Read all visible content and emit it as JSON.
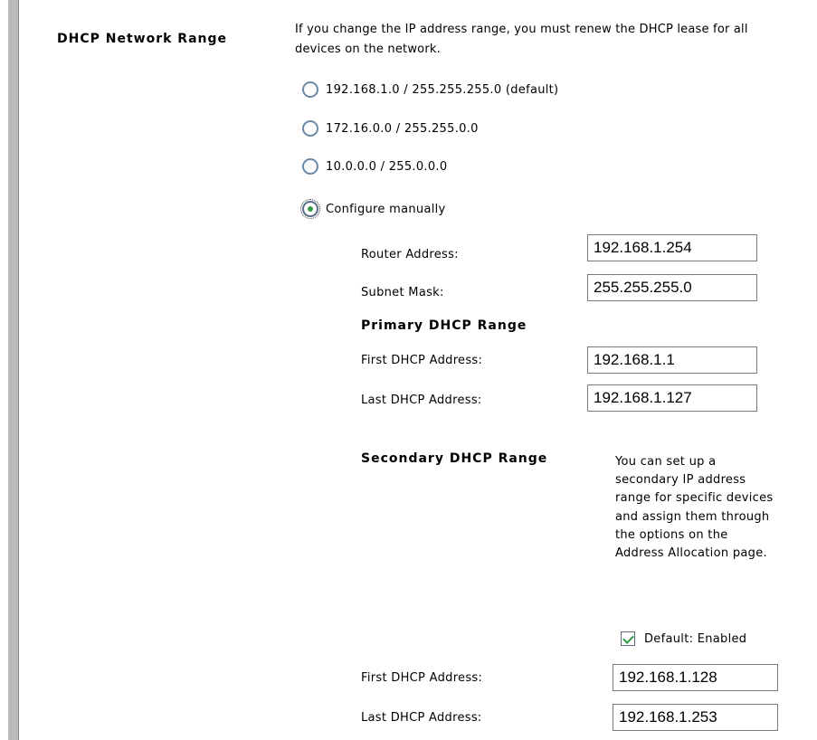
{
  "section": {
    "title": "DHCP Network Range",
    "intro": "If you change the IP address range, you must renew the DHCP lease for all devices on the network."
  },
  "range_options": [
    {
      "label": "192.168.1.0 / 255.255.255.0 (default)",
      "selected": false
    },
    {
      "label": "172.16.0.0 / 255.255.0.0",
      "selected": false
    },
    {
      "label": "10.0.0.0 / 255.0.0.0",
      "selected": false
    },
    {
      "label": "Configure manually",
      "selected": true
    }
  ],
  "manual": {
    "router_label": "Router Address:",
    "router_value": "192.168.1.254",
    "subnet_label": "Subnet Mask:",
    "subnet_value": "255.255.255.0",
    "primary": {
      "heading": "Primary DHCP Range",
      "first_label": "First DHCP Address:",
      "first_value": "192.168.1.1",
      "last_label": "Last DHCP Address:",
      "last_value": "192.168.1.127"
    },
    "secondary": {
      "heading": "Secondary DHCP Range",
      "note": "You can set up a secondary IP address range for specific devices and assign them through the options on the Address Allocation page.",
      "checkbox_label": "Default: Enabled",
      "checkbox_checked": true,
      "first_label": "First DHCP Address:",
      "first_value": "192.168.1.128",
      "last_label": "Last DHCP Address:",
      "last_value": "192.168.1.253"
    }
  },
  "colors": {
    "rail": "#b9b9b9",
    "radio_border": "#6d89a8",
    "check_green": "#2f9c43"
  }
}
